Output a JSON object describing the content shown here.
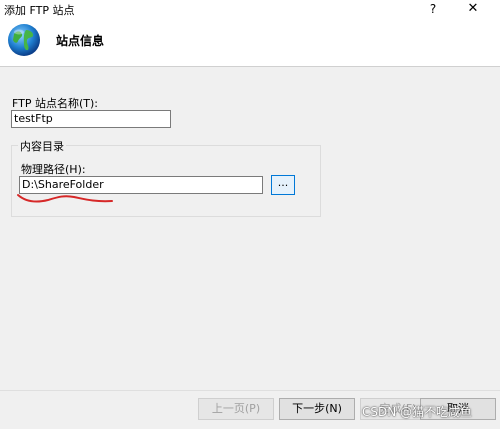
{
  "window": {
    "title": "添加 FTP 站点",
    "help_glyph": "?",
    "close_glyph": "✕"
  },
  "header": {
    "title": "站点信息",
    "icon": "globe-icon"
  },
  "form": {
    "site_name_label": "FTP 站点名称(T):",
    "site_name_value": "testFtp",
    "content_dir_group": "内容目录",
    "physical_path_label": "物理路径(H):",
    "physical_path_value": "D:\\ShareFolder",
    "browse_label": "..."
  },
  "footer": {
    "prev_label": "上一页(P)",
    "next_label": "下一步(N)",
    "finish_label": "完成(F)",
    "cancel_label": "取消",
    "watermark": "CSDN @猫不吃咸鱼"
  },
  "colors": {
    "accent": "#0078d7",
    "annotation": "#d62828"
  }
}
